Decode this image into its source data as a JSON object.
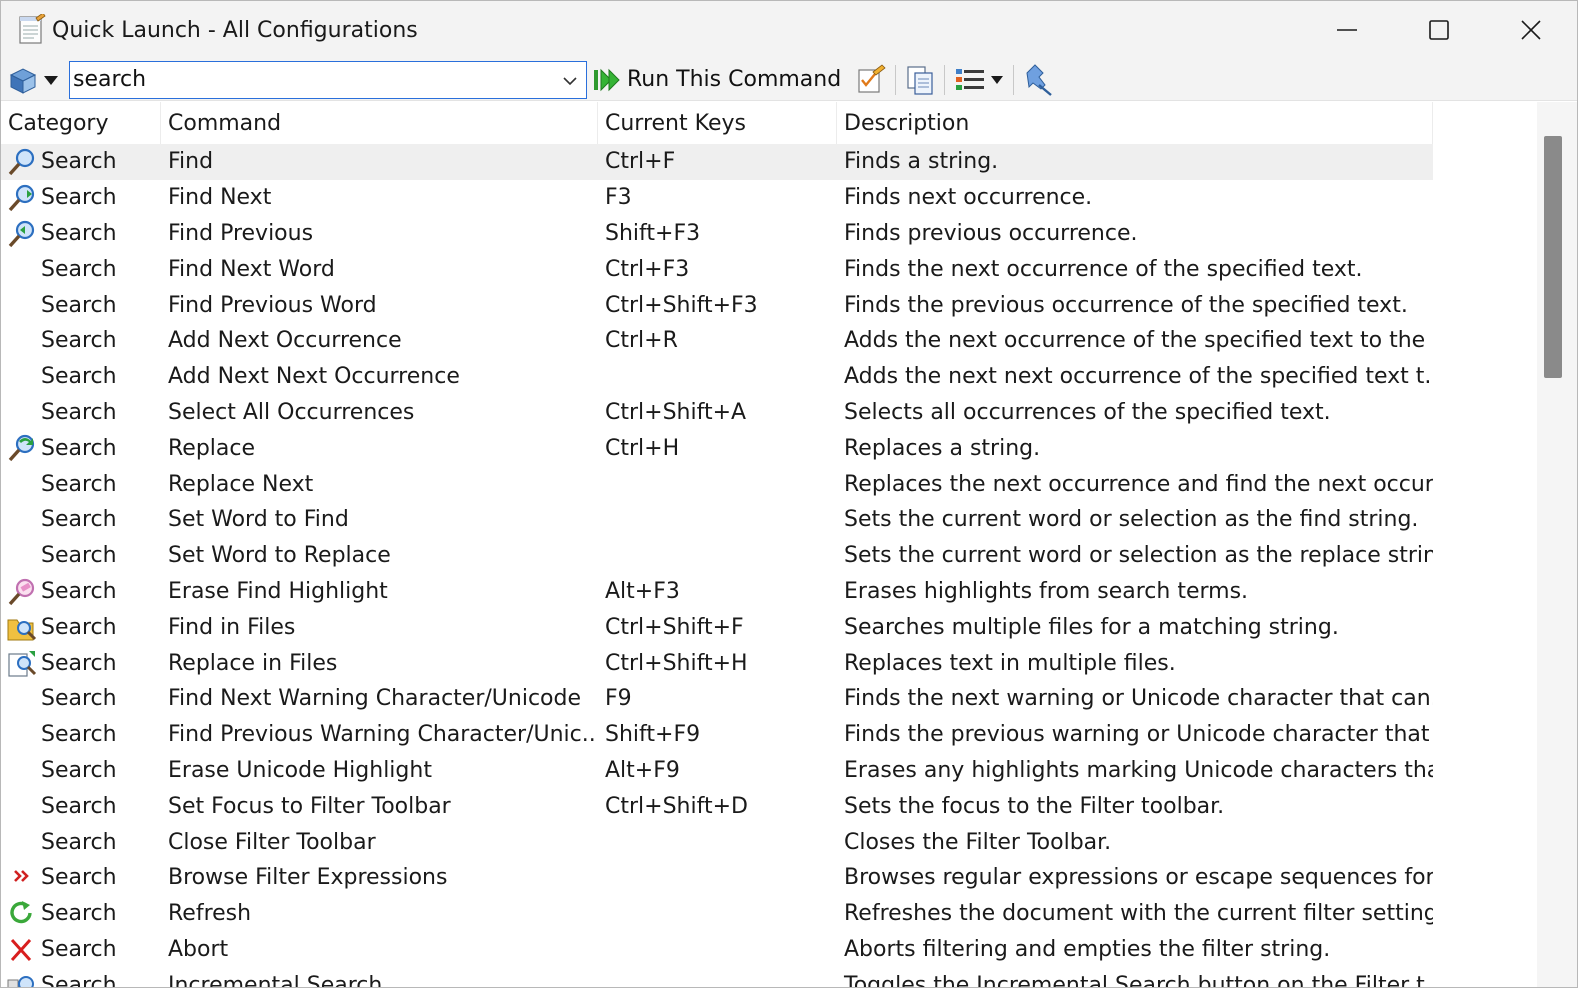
{
  "window": {
    "title": "Quick Launch - All Configurations"
  },
  "toolbar": {
    "search_value": "search",
    "run_label": "Run This Command"
  },
  "columns": {
    "category": "Category",
    "command": "Command",
    "keys": "Current Keys",
    "description": "Description"
  },
  "rows": [
    {
      "category": "Search",
      "command": "Find",
      "keys": "Ctrl+F",
      "description": "Finds a string.",
      "icon": "find-icon"
    },
    {
      "category": "Search",
      "command": "Find Next",
      "keys": "F3",
      "description": "Finds next occurrence.",
      "icon": "find-next-icon"
    },
    {
      "category": "Search",
      "command": "Find Previous",
      "keys": "Shift+F3",
      "description": "Finds previous occurrence.",
      "icon": "find-previous-icon"
    },
    {
      "category": "Search",
      "command": "Find Next Word",
      "keys": "Ctrl+F3",
      "description": "Finds the next occurrence of the specified text.",
      "icon": ""
    },
    {
      "category": "Search",
      "command": "Find Previous Word",
      "keys": "Ctrl+Shift+F3",
      "description": "Finds the previous occurrence of the specified text.",
      "icon": ""
    },
    {
      "category": "Search",
      "command": "Add Next Occurrence",
      "keys": "Ctrl+R",
      "description": "Adds the next occurrence of the specified text to the ...",
      "icon": ""
    },
    {
      "category": "Search",
      "command": "Add Next Next Occurrence",
      "keys": "",
      "description": "Adds the next next occurrence of the specified text t...",
      "icon": ""
    },
    {
      "category": "Search",
      "command": "Select All Occurrences",
      "keys": "Ctrl+Shift+A",
      "description": "Selects all occurrences of the specified text.",
      "icon": ""
    },
    {
      "category": "Search",
      "command": "Replace",
      "keys": "Ctrl+H",
      "description": "Replaces a string.",
      "icon": "replace-icon"
    },
    {
      "category": "Search",
      "command": "Replace Next",
      "keys": "",
      "description": "Replaces the next occurrence and find the next occur...",
      "icon": ""
    },
    {
      "category": "Search",
      "command": "Set Word to Find",
      "keys": "",
      "description": "Sets the current word or selection as the find string.",
      "icon": ""
    },
    {
      "category": "Search",
      "command": "Set Word to Replace",
      "keys": "",
      "description": "Sets the current word or selection as the replace string.",
      "icon": ""
    },
    {
      "category": "Search",
      "command": "Erase Find Highlight",
      "keys": "Alt+F3",
      "description": "Erases highlights from search terms.",
      "icon": "erase-highlight-icon"
    },
    {
      "category": "Search",
      "command": "Find in Files",
      "keys": "Ctrl+Shift+F",
      "description": "Searches multiple files for a matching string.",
      "icon": "find-in-files-icon"
    },
    {
      "category": "Search",
      "command": "Replace in Files",
      "keys": "Ctrl+Shift+H",
      "description": "Replaces text in multiple files.",
      "icon": "replace-in-files-icon"
    },
    {
      "category": "Search",
      "command": "Find Next Warning Character/Unicode",
      "keys": "F9",
      "description": "Finds the next warning or Unicode character that can...",
      "icon": ""
    },
    {
      "category": "Search",
      "command": "Find Previous Warning Character/Unic...",
      "keys": "Shift+F9",
      "description": "Finds the previous warning or Unicode character that ...",
      "icon": ""
    },
    {
      "category": "Search",
      "command": "Erase Unicode Highlight",
      "keys": "Alt+F9",
      "description": "Erases any highlights marking Unicode characters tha...",
      "icon": ""
    },
    {
      "category": "Search",
      "command": "Set Focus to Filter Toolbar",
      "keys": "Ctrl+Shift+D",
      "description": "Sets the focus to the Filter toolbar.",
      "icon": ""
    },
    {
      "category": "Search",
      "command": "Close Filter Toolbar",
      "keys": "",
      "description": "Closes the Filter Toolbar.",
      "icon": ""
    },
    {
      "category": "Search",
      "command": "Browse Filter Expressions",
      "keys": "",
      "description": "Browses regular expressions or escape sequences for ...",
      "icon": "browse-expressions-icon"
    },
    {
      "category": "Search",
      "command": "Refresh",
      "keys": "",
      "description": "Refreshes the document with the current filter settings.",
      "icon": "refresh-icon"
    },
    {
      "category": "Search",
      "command": "Abort",
      "keys": "",
      "description": "Aborts filtering and empties the filter string.",
      "icon": "abort-icon"
    },
    {
      "category": "Search",
      "command": "Incremental Search",
      "keys": "",
      "description": "Toggles the Incremental Search button on the Filter t...",
      "icon": "incremental-search-icon"
    }
  ]
}
